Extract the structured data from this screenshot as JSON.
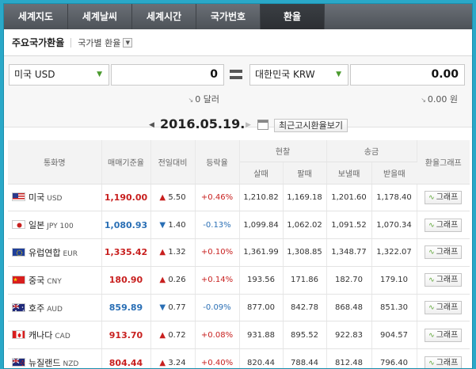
{
  "tabs": [
    {
      "label": "세계지도",
      "active": false
    },
    {
      "label": "세계날씨",
      "active": false
    },
    {
      "label": "세계시간",
      "active": false
    },
    {
      "label": "국가번호",
      "active": false
    },
    {
      "label": "환율",
      "active": true
    }
  ],
  "subheader": {
    "title": "주요국가환율",
    "dropdown_label": "국가별 환율"
  },
  "converter": {
    "from_currency": "미국 USD",
    "from_amount": "0",
    "from_hint": "0 달러",
    "to_currency": "대한민국 KRW",
    "to_amount": "0.00",
    "to_hint": "0.00 원"
  },
  "date": "2016.05.19.",
  "recent_button": "최근고시환율보기",
  "table": {
    "headers": {
      "currency": "통화명",
      "base_rate": "매매기준율",
      "change": "전일대비",
      "change_pct": "등락율",
      "cash": "현찰",
      "wire": "송금",
      "graph": "환율그래프",
      "buy": "살때",
      "sell": "팔때",
      "send": "보낼때",
      "receive": "받을때"
    },
    "rows": [
      {
        "flag": "us",
        "name": "미국",
        "code": "USD",
        "rate": "1,190.00",
        "rate_color": "#c8201f",
        "arrow": "▲",
        "direction": "up",
        "change": "5.50",
        "pct": "+0.46%",
        "cash_buy": "1,210.82",
        "cash_sell": "1,169.18",
        "send": "1,201.60",
        "receive": "1,178.40",
        "graph_label": "그래프"
      },
      {
        "flag": "jp",
        "name": "일본",
        "code": "JPY 100",
        "rate": "1,080.93",
        "rate_color": "#2a6fb5",
        "arrow": "▼",
        "direction": "down",
        "change": "1.40",
        "pct": "-0.13%",
        "cash_buy": "1,099.84",
        "cash_sell": "1,062.02",
        "send": "1,091.52",
        "receive": "1,070.34",
        "graph_label": "그래프"
      },
      {
        "flag": "eu",
        "name": "유럽연합",
        "code": "EUR",
        "rate": "1,335.42",
        "rate_color": "#c8201f",
        "arrow": "▲",
        "direction": "up",
        "change": "1.32",
        "pct": "+0.10%",
        "cash_buy": "1,361.99",
        "cash_sell": "1,308.85",
        "send": "1,348.77",
        "receive": "1,322.07",
        "graph_label": "그래프"
      },
      {
        "flag": "cn",
        "name": "중국",
        "code": "CNY",
        "rate": "180.90",
        "rate_color": "#c8201f",
        "arrow": "▲",
        "direction": "up",
        "change": "0.26",
        "pct": "+0.14%",
        "cash_buy": "193.56",
        "cash_sell": "171.86",
        "send": "182.70",
        "receive": "179.10",
        "graph_label": "그래프"
      },
      {
        "flag": "au",
        "name": "호주",
        "code": "AUD",
        "rate": "859.89",
        "rate_color": "#2a6fb5",
        "arrow": "▼",
        "direction": "down",
        "change": "0.77",
        "pct": "-0.09%",
        "cash_buy": "877.00",
        "cash_sell": "842.78",
        "send": "868.48",
        "receive": "851.30",
        "graph_label": "그래프"
      },
      {
        "flag": "ca",
        "name": "캐나다",
        "code": "CAD",
        "rate": "913.70",
        "rate_color": "#c8201f",
        "arrow": "▲",
        "direction": "up",
        "change": "0.72",
        "pct": "+0.08%",
        "cash_buy": "931.88",
        "cash_sell": "895.52",
        "send": "922.83",
        "receive": "904.57",
        "graph_label": "그래프"
      },
      {
        "flag": "nz",
        "name": "뉴질랜드",
        "code": "NZD",
        "rate": "804.44",
        "rate_color": "#c8201f",
        "arrow": "▲",
        "direction": "up",
        "change": "3.24",
        "pct": "+0.40%",
        "cash_buy": "820.44",
        "cash_sell": "788.44",
        "send": "812.48",
        "receive": "796.40",
        "graph_label": "그래프"
      }
    ]
  }
}
